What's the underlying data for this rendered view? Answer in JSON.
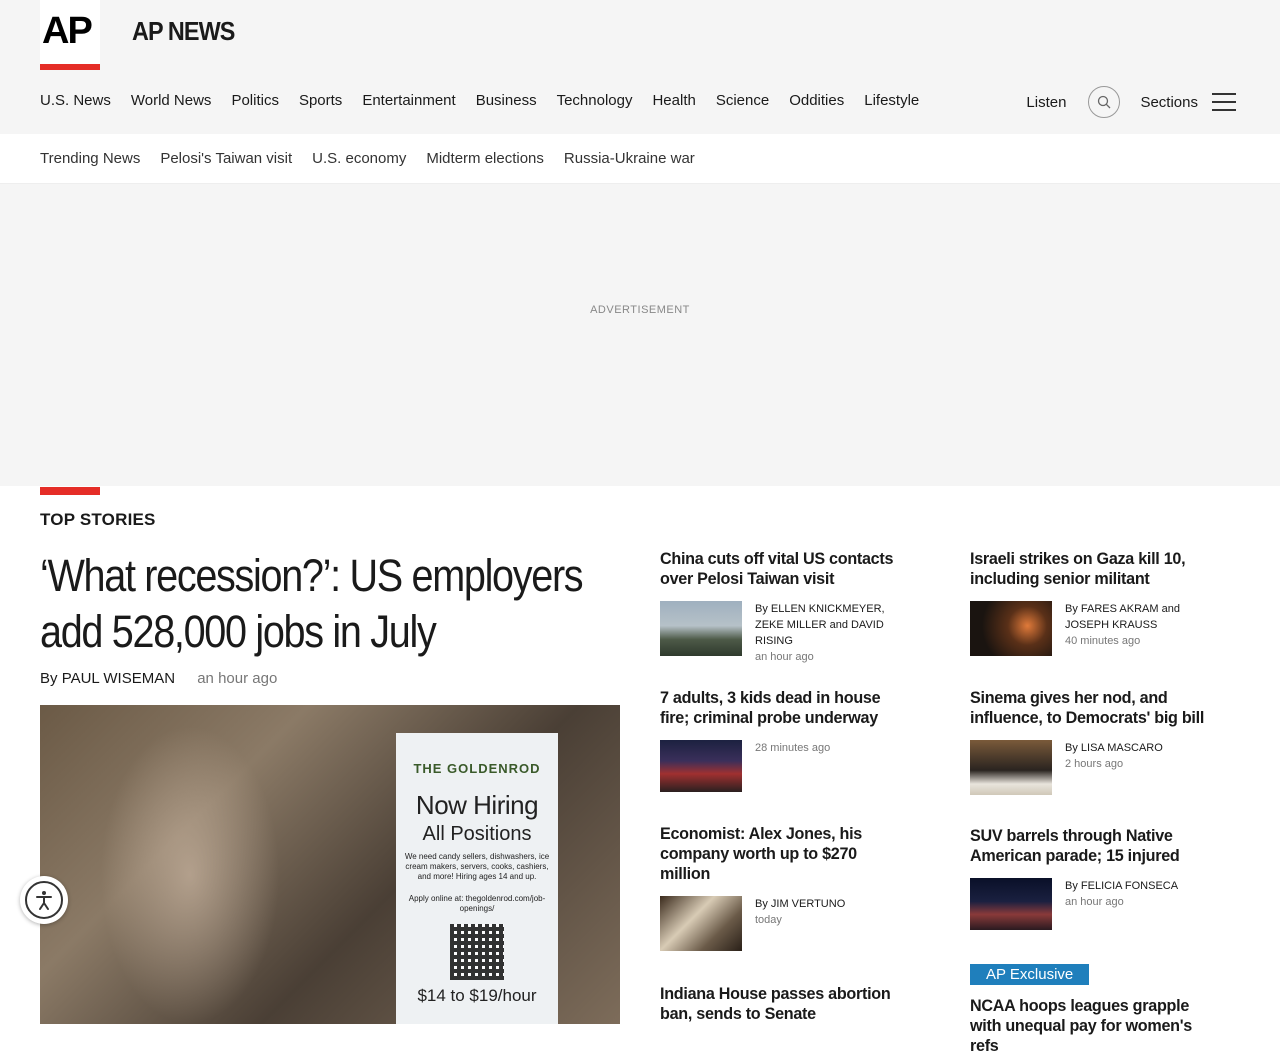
{
  "brand": {
    "logo_text": "AP",
    "name": "AP NEWS"
  },
  "nav": {
    "items": [
      "U.S. News",
      "World News",
      "Politics",
      "Sports",
      "Entertainment",
      "Business",
      "Technology",
      "Health",
      "Science",
      "Oddities",
      "Lifestyle"
    ],
    "listen": "Listen",
    "sections": "Sections"
  },
  "subnav": {
    "items": [
      "Trending News",
      "Pelosi's Taiwan visit",
      "U.S. economy",
      "Midterm elections",
      "Russia-Ukraine war"
    ]
  },
  "ad": {
    "label": "ADVERTISEMENT"
  },
  "top_stories": {
    "title": "TOP STORIES",
    "lead": {
      "headline": "‘What recession?’: US employers add 528,000 jobs in July",
      "by": "By",
      "author": "PAUL WISEMAN",
      "time": "an hour ago",
      "image": {
        "brand": "THE GOLDENROD",
        "hiring": "Now Hiring",
        "positions": "All Positions",
        "small": "We need candy sellers, dishwashers, ice cream makers, servers, cooks, cashiers, and more! Hiring ages 14 and up.",
        "apply": "Apply online at: thegoldenrod.com/job-openings/",
        "pay": "$14 to $19/hour"
      }
    },
    "col1": [
      {
        "headline": "China cuts off vital US contacts over Pelosi Taiwan visit",
        "byline": "By ELLEN KNICKMEYER, ZEKE MILLER and DAVID RISING",
        "time": "an hour ago"
      },
      {
        "headline": "7 adults, 3 kids dead in house fire; criminal probe underway",
        "byline": "",
        "time": "28 minutes ago"
      },
      {
        "headline": "Economist: Alex Jones, his company worth up to $270 million",
        "byline": "By JIM VERTUNO",
        "time": "today"
      },
      {
        "headline": "Indiana House passes abortion ban, sends to Senate",
        "byline": "",
        "time": ""
      }
    ],
    "col2": [
      {
        "headline": "Israeli strikes on Gaza kill 10, including senior militant",
        "byline": "By FARES AKRAM and JOSEPH KRAUSS",
        "time": "40 minutes ago"
      },
      {
        "headline": "Sinema gives her nod, and influence, to Democrats' big bill",
        "byline": "By LISA MASCARO",
        "time": "2 hours ago"
      },
      {
        "headline": "SUV barrels through Native American parade; 15 injured",
        "byline": "By FELICIA FONSECA",
        "time": "an hour ago"
      },
      {
        "badge": "AP Exclusive",
        "headline": "NCAA hoops leagues grapple with unequal pay for women's refs",
        "byline": "",
        "time": ""
      }
    ]
  }
}
